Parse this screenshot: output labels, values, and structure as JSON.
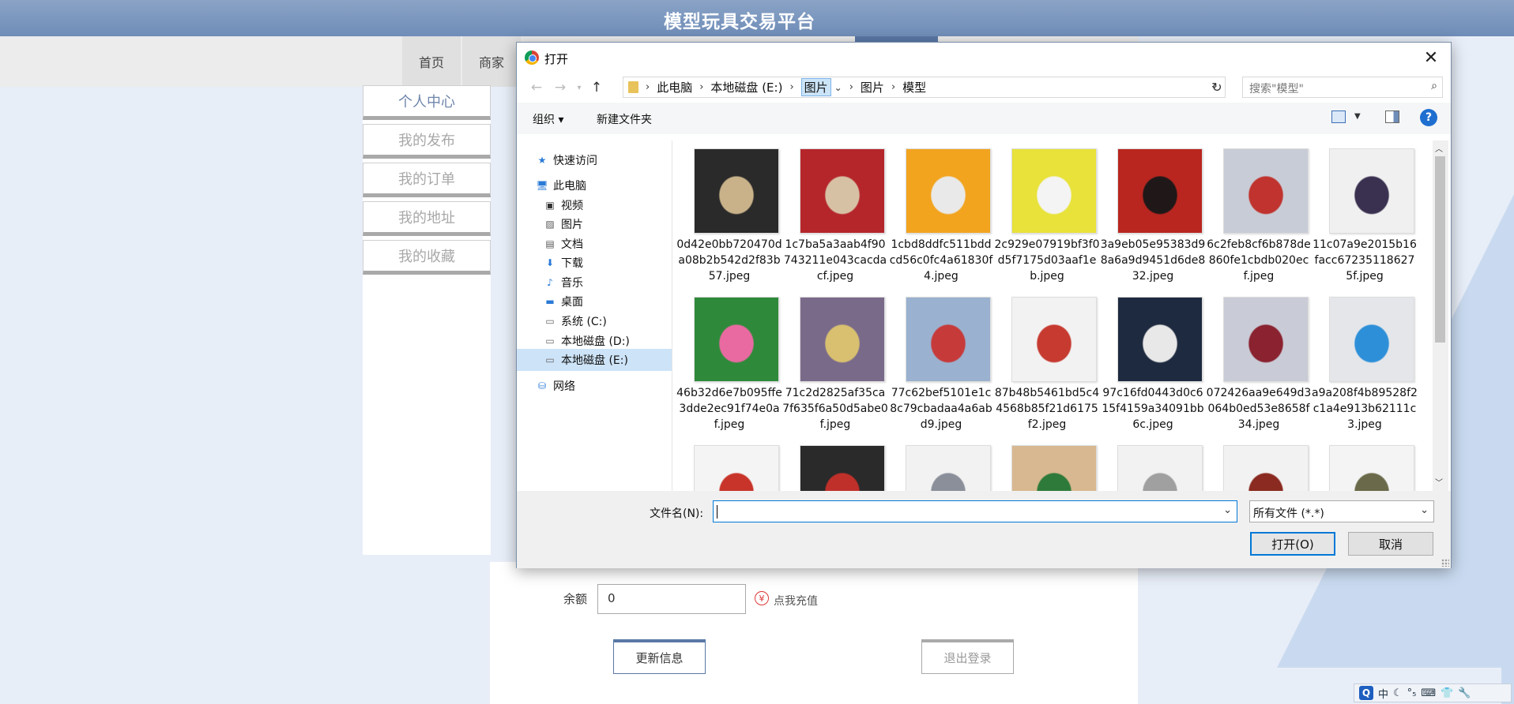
{
  "site": {
    "title": "模型玩具交易平台",
    "nav": [
      "首页",
      "商家"
    ],
    "sidebar": [
      "个人中心",
      "我的发布",
      "我的订单",
      "我的地址",
      "我的收藏"
    ],
    "balance_label": "余额",
    "balance_value": "0",
    "recharge_icon": "¥",
    "recharge_label": "点我充值",
    "update_label": "更新信息",
    "logout_label": "退出登录"
  },
  "dialog": {
    "title": "打开",
    "close_glyph": "✕",
    "breadcrumb": [
      "此电脑",
      "本地磁盘 (E:)",
      "图片",
      "图片",
      "模型"
    ],
    "search_placeholder": "搜索\"模型\"",
    "toolbar": {
      "organize": "组织 ▾",
      "new_folder": "新建文件夹"
    },
    "help": "?",
    "nav_pane": [
      {
        "label": "快速访问",
        "icon": "star-icon"
      },
      {
        "label": "此电脑",
        "icon": "computer-icon"
      },
      {
        "label": "视频",
        "icon": "video-icon"
      },
      {
        "label": "图片",
        "icon": "pictures-icon"
      },
      {
        "label": "文档",
        "icon": "documents-icon"
      },
      {
        "label": "下载",
        "icon": "download-icon"
      },
      {
        "label": "音乐",
        "icon": "music-icon"
      },
      {
        "label": "桌面",
        "icon": "desktop-icon"
      },
      {
        "label": "系统 (C:)",
        "icon": "drive-icon"
      },
      {
        "label": "本地磁盘 (D:)",
        "icon": "drive-icon"
      },
      {
        "label": "本地磁盘 (E:)",
        "icon": "drive-icon",
        "selected": true
      },
      {
        "label": "网络",
        "icon": "network-icon"
      }
    ],
    "files": [
      {
        "name": "0d42e0bb720470da08b2b542d2f83b57.jpeg",
        "colors": [
          "#2a2a2a",
          "#c9b28a"
        ]
      },
      {
        "name": "1c7ba5a3aab4f90743211e043cacdacf.jpeg",
        "colors": [
          "#b5262b",
          "#d7c1a5"
        ]
      },
      {
        "name": "1cbd8ddfc511bddcd56c0fc4a61830f4.jpeg",
        "colors": [
          "#f2a41f",
          "#e9e9e9"
        ]
      },
      {
        "name": "2c929e07919bf3f0d5f7175d03aaf1eb.jpeg",
        "colors": [
          "#e8e23a",
          "#f4f4f4"
        ]
      },
      {
        "name": "3a9eb05e95383d98a6a9d9451d6de832.jpeg",
        "colors": [
          "#b8261f",
          "#201818"
        ]
      },
      {
        "name": "6c2feb8cf6b878de860fe1cbdb020ecf.jpeg",
        "colors": [
          "#c8ccd6",
          "#c0332e"
        ]
      },
      {
        "name": "11c07a9e2015b16facc672351186275f.jpeg",
        "colors": [
          "#f0f0f0",
          "#3a3150"
        ]
      },
      {
        "name": "46b32d6e7b095ffe3dde2ec91f74e0af.jpeg",
        "colors": [
          "#2e8a3a",
          "#e86aa0"
        ]
      },
      {
        "name": "71c2d2825af35ca7f635f6a50d5abe0f.jpeg",
        "colors": [
          "#7a6a8a",
          "#d8c070"
        ]
      },
      {
        "name": "77c62bef5101e1c8c79cbadaa4a6abd9.jpeg",
        "colors": [
          "#9ab1cf",
          "#c73a3a"
        ]
      },
      {
        "name": "87b48b5461bd5c44568b85f21d6175f2.jpeg",
        "colors": [
          "#f2f2f2",
          "#c63a30"
        ]
      },
      {
        "name": "97c16fd0443d0c615f4159a34091bb6c.jpeg",
        "colors": [
          "#1e2a40",
          "#e8e8e8"
        ]
      },
      {
        "name": "072426aa9e649d3064b0ed53e8658f34.jpeg",
        "colors": [
          "#c9cbd6",
          "#8a2230"
        ]
      },
      {
        "name": "a9a208f4b89528f2c1a4e913b62111c3.jpeg",
        "colors": [
          "#e4e6ea",
          "#2d8fd8"
        ]
      },
      {
        "name": "",
        "colors": [
          "#f4f4f4",
          "#c8342a"
        ]
      },
      {
        "name": "",
        "colors": [
          "#2a2a2a",
          "#c0302a"
        ]
      },
      {
        "name": "",
        "colors": [
          "#f2f2f2",
          "#8a8f9a"
        ]
      },
      {
        "name": "",
        "colors": [
          "#d8b890",
          "#2e7a3a"
        ]
      },
      {
        "name": "",
        "colors": [
          "#f2f2f2",
          "#a0a0a0"
        ]
      },
      {
        "name": "",
        "colors": [
          "#f2f2f2",
          "#8a2a20"
        ]
      },
      {
        "name": "",
        "colors": [
          "#f4f4f4",
          "#6a6a4a"
        ]
      }
    ],
    "filename_label": "文件名(N):",
    "filename_value": "",
    "filetype": "所有文件 (*.*)",
    "open_label": "打开(O)",
    "cancel_label": "取消"
  },
  "tray": [
    "Q",
    "中",
    "☾",
    "°₅",
    "⌨",
    "👕",
    "🔧"
  ]
}
